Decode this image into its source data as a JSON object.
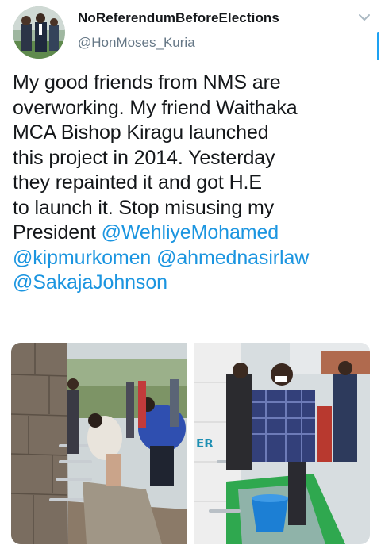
{
  "tweet": {
    "display_name": "NoReferendumBeforeElections",
    "handle": "@HonMoses_Kuria",
    "text_lines": [
      "My good friends from NMS are",
      "overworking. My friend Waithaka",
      "MCA Bishop Kiragu launched",
      "this project in 2014. Yesterday",
      "they repainted it and got H.E",
      "to launch it. Stop misusing my"
    ],
    "line7_prefix": "President ",
    "mentions": [
      "@WehliyeMohamed",
      "@kipmurkomen",
      "@ahmednasirlaw",
      "@SakajaJohnson"
    ],
    "photo_sign_text": "ER",
    "colors": {
      "text": "#14171a",
      "link": "#1b95e0",
      "handle": "#657786",
      "accent": "#1da1f2"
    },
    "icons": {
      "menu": "chevron-down-icon"
    }
  }
}
